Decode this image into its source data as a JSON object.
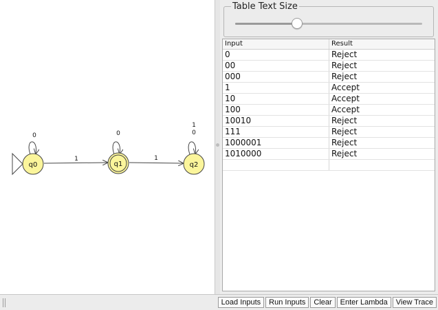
{
  "automaton": {
    "states": [
      {
        "id": "q0",
        "label": "q0",
        "initial": true,
        "final": false
      },
      {
        "id": "q1",
        "label": "q1",
        "initial": false,
        "final": true
      },
      {
        "id": "q2",
        "label": "q2",
        "initial": false,
        "final": false
      }
    ],
    "transitions": [
      {
        "from": "q0",
        "to": "q0",
        "label": "0"
      },
      {
        "from": "q0",
        "to": "q1",
        "label": "1"
      },
      {
        "from": "q1",
        "to": "q1",
        "label": "0"
      },
      {
        "from": "q1",
        "to": "q2",
        "label": "1"
      },
      {
        "from": "q2",
        "to": "q2",
        "label": "1",
        "label2": "0"
      }
    ],
    "state_fill": "#fbf59b",
    "state_stroke": "#444444"
  },
  "size_control": {
    "title": "Table Text Size",
    "level": 0.33
  },
  "table": {
    "headers": [
      "Input",
      "Result"
    ],
    "rows": [
      {
        "input": "0",
        "result": "Reject"
      },
      {
        "input": "00",
        "result": "Reject"
      },
      {
        "input": "000",
        "result": "Reject"
      },
      {
        "input": "1",
        "result": "Accept"
      },
      {
        "input": "10",
        "result": "Accept"
      },
      {
        "input": "100",
        "result": "Accept"
      },
      {
        "input": "10010",
        "result": "Reject"
      },
      {
        "input": "111",
        "result": "Reject"
      },
      {
        "input": "1000001",
        "result": "Reject"
      },
      {
        "input": "1010000",
        "result": "Reject"
      },
      {
        "input": "",
        "result": ""
      }
    ]
  },
  "buttons": {
    "load": "Load Inputs",
    "run": "Run Inputs",
    "clear": "Clear",
    "lambda": "Enter Lambda",
    "trace": "View Trace"
  }
}
